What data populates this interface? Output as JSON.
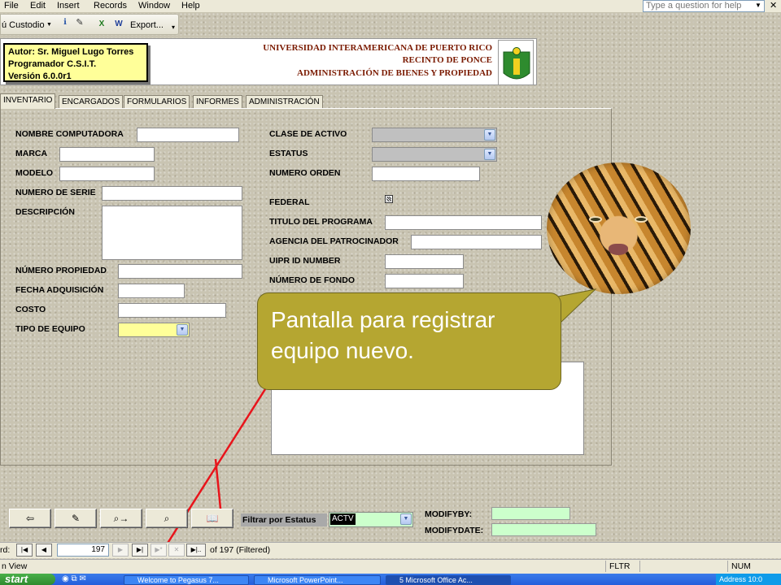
{
  "menu": [
    "File",
    "Edit",
    "Insert",
    "Records",
    "Window",
    "Help"
  ],
  "help_box": {
    "placeholder": "Type a question for help"
  },
  "toolbar": {
    "dropdown_label": "ú Custodio",
    "export_label": "Export..."
  },
  "header": {
    "author_lines": [
      "Autor:  Sr. Miguel Lugo Torres",
      "Programador C.S.I.T.",
      "Versión 6.0.0r1"
    ],
    "university_lines": [
      "UNIVERSIDAD INTERAMERICANA DE PUERTO RICO",
      "RECINTO DE PONCE",
      "ADMINISTRACIÓN DE BIENES Y PROPIEDAD"
    ]
  },
  "tabs": [
    "INVENTARIO",
    "ENCARGADOS",
    "FORMULARIOS",
    "INFORMES",
    "ADMINISTRACIÓN"
  ],
  "form_left": {
    "nombre_computadora": "NOMBRE COMPUTADORA",
    "marca": "MARCA",
    "modelo": "MODELO",
    "numero_serie": "NUMERO DE SERIE",
    "descripcion": "DESCRIPCIÓN",
    "numero_propiedad": "NÚMERO PROPIEDAD",
    "fecha_adquisicion": "FECHA ADQUISICIÓN",
    "costo": "COSTO",
    "tipo_equipo": "TIPO DE EQUIPO"
  },
  "form_right": {
    "clase_activo": "CLASE DE ACTIVO",
    "estatus": "ESTATUS",
    "numero_orden": "NUMERO ORDEN",
    "federal": "FEDERAL",
    "titulo_programa": "TITULO DEL PROGRAMA",
    "agencia": "AGENCIA DEL PATROCINADOR",
    "uipr_id": "UIPR ID NUMBER",
    "numero_fondo": "NÚMERO DE FONDO"
  },
  "callout": {
    "text": "Pantalla para registrar equipo nuevo."
  },
  "filter": {
    "label": "Filtrar por Estatus",
    "value": "ACTV"
  },
  "modify": {
    "by_label": "MODIFYBY:",
    "date_label": "MODIFYDATE:"
  },
  "record_nav": {
    "prefix": "rd:",
    "current": "197",
    "total_text": "of  197 (Filtered)"
  },
  "statusbar": {
    "view": "n View",
    "fltr": "FLTR",
    "num": "NUM"
  },
  "taskbar": {
    "start": "start",
    "tasks": [
      "Welcome to Pegasus 7...",
      "Microsoft PowerPoint...",
      "5 Microsoft Office Ac..."
    ],
    "tray_text": "Address  10:0"
  },
  "colors": {
    "callout": "#b5a631",
    "header_text": "#7a1a00",
    "filter_field": "#ccffcc",
    "arrow": "#e8141b"
  }
}
